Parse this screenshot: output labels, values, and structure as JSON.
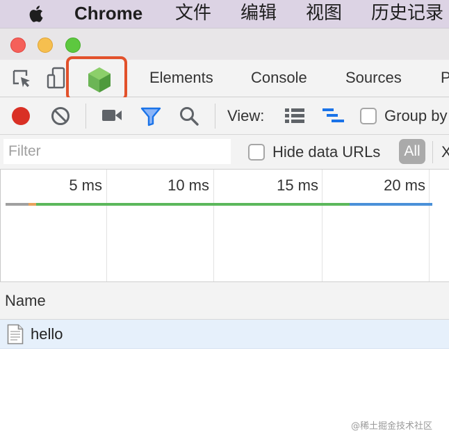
{
  "menubar": {
    "app_name": "Chrome",
    "items": [
      "文件",
      "编辑",
      "视图",
      "历史记录"
    ]
  },
  "tabs": {
    "items": [
      "Elements",
      "Console",
      "Sources",
      "P"
    ]
  },
  "toolbar": {
    "view_label": "View:",
    "group_by_label": "Group by"
  },
  "filter": {
    "placeholder": "Filter",
    "hide_data_urls_label": "Hide data URLs",
    "all_label": "All",
    "x_label": "X"
  },
  "timeline": {
    "ticks": [
      "5 ms",
      "10 ms",
      "15 ms",
      "20 ms"
    ]
  },
  "table": {
    "name_header": "Name",
    "rows": [
      {
        "name": "hello"
      }
    ]
  },
  "watermark": "@稀土掘金技术社区",
  "colors": {
    "highlight": "#e2512b",
    "record": "#d93025",
    "filter_icon": "#1a73e8",
    "node_icon": "#6cb556",
    "selected_row": "#e6f0fb",
    "timeline_green": "#5cb85c",
    "timeline_blue": "#4a90d9"
  },
  "icons": [
    "apple-icon",
    "inspect-element-icon",
    "device-toolbar-icon",
    "node-js-icon",
    "record-icon",
    "clear-icon",
    "screenshot-video-icon",
    "filter-icon",
    "search-icon",
    "list-view-icon",
    "waterfall-view-icon",
    "document-icon"
  ]
}
